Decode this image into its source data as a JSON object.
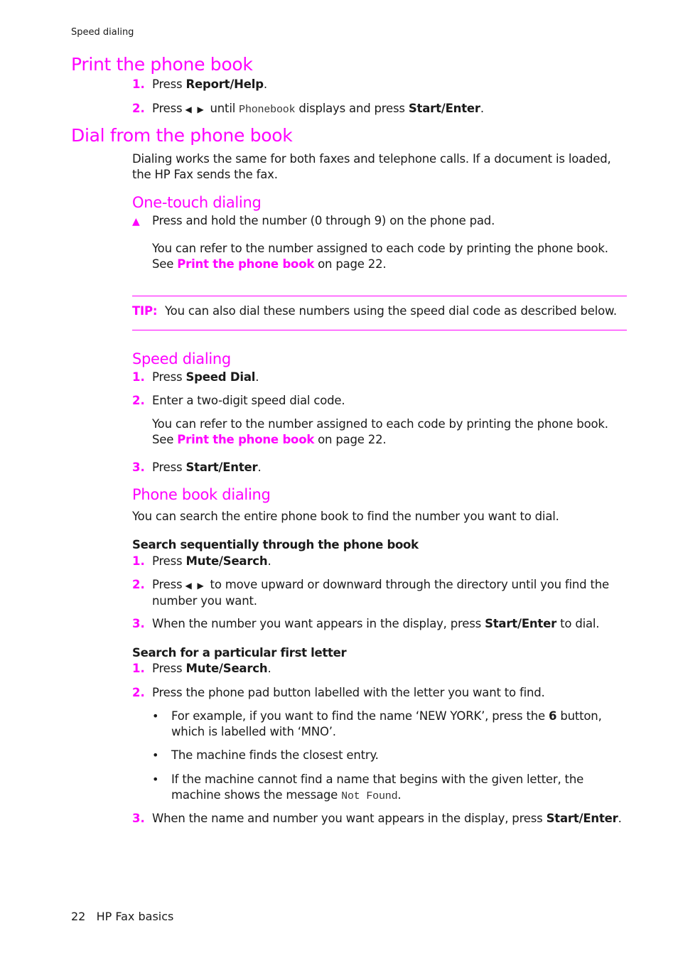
{
  "running_header": "Speed dialing",
  "sections": {
    "print": {
      "title": "Print the phone book",
      "steps": [
        {
          "n": "1.",
          "pre": "Press ",
          "bold": "Report/Help",
          "post": "."
        },
        {
          "n": "2.",
          "pre": "Press",
          "left_icon": "◀",
          "right_icon": "▶",
          "mid": "until ",
          "mono": "Phonebook",
          "post2": " displays and press ",
          "bold": "Start/Enter",
          "post": "."
        }
      ]
    },
    "dial": {
      "title": "Dial from the phone book",
      "intro": "Dialing works the same for both faxes and telephone calls. If a document is loaded, the HP Fax sends the fax."
    },
    "onetouch": {
      "title": "One-touch dialing",
      "step": "Press and hold the number (0 through 9) on the phone pad.",
      "marker": "▲",
      "note_pre": "You can refer to the number assigned to each code by printing the phone book. See ",
      "note_link": "Print the phone book",
      "note_post": " on page 22.",
      "tip_label": "TIP:",
      "tip_text": "You can also dial these numbers using the speed dial code as described below."
    },
    "speed": {
      "title": "Speed dialing",
      "step1_pre": "Press ",
      "step1_bold": "Speed Dial",
      "step1_post": ".",
      "step2": "Enter a two-digit speed dial code.",
      "note_pre": "You can refer to the number assigned to each code by printing the phone book. See ",
      "note_link": "Print the phone book",
      "note_post": " on page 22.",
      "step3_pre": "Press ",
      "step3_bold": "Start/Enter",
      "step3_post": "."
    },
    "phonebook": {
      "title": "Phone book dialing",
      "intro": "You can search the entire phone book to find the number you want to dial.",
      "seq_title": "Search sequentially through the phone book",
      "seq1_pre": "Press ",
      "seq1_bold": "Mute/Search",
      "seq1_post": ".",
      "seq2_pre": "Press",
      "seq2_post": "to move upward or downward through the directory until you find the number you want.",
      "seq3_pre": "When the number you want appears in the display, press ",
      "seq3_bold": "Start/Enter",
      "seq3_post": " to dial.",
      "letter_title": "Search for a particular first letter",
      "let1_pre": "Press ",
      "let1_bold": "Mute/Search",
      "let1_post": ".",
      "let2": "Press the phone pad button labelled with the letter you want to find.",
      "bullet1_pre": "For example, if you want to find the name ‘NEW YORK’, press the ",
      "bullet1_bold": "6",
      "bullet1_post": " button, which is labelled with ‘MNO’.",
      "bullet2": "The machine finds the closest entry.",
      "bullet3_pre": "If the machine cannot find a name that begins with the given letter, the machine shows the message ",
      "bullet3_mono": "Not Found",
      "bullet3_post": ".",
      "let3_pre": "When the name and number you want appears in the display, press ",
      "let3_bold": "Start/Enter",
      "let3_post": "."
    }
  },
  "footer": {
    "page": "22",
    "chapter": "HP Fax basics"
  },
  "nums": {
    "one": "1.",
    "two": "2.",
    "three": "3."
  },
  "bullet_char": "•"
}
